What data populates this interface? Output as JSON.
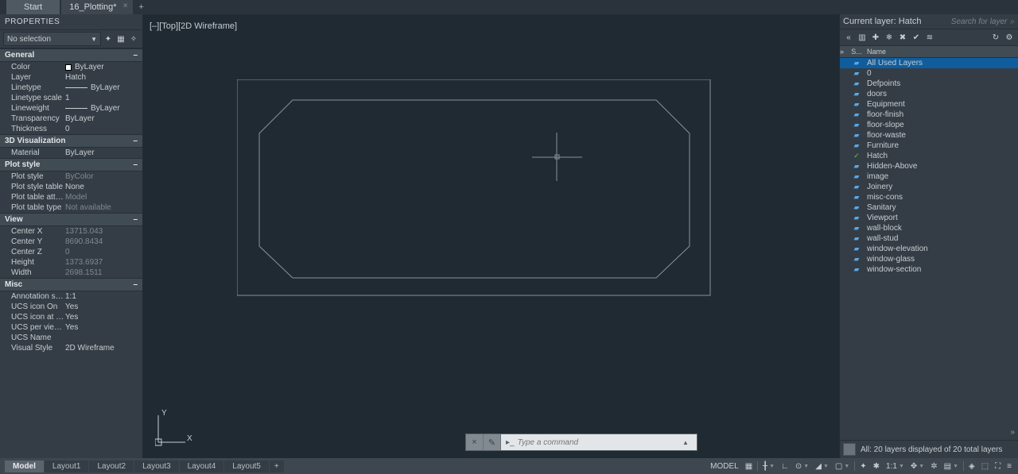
{
  "tabs": {
    "start": "Start",
    "file": "16_Plotting*"
  },
  "properties": {
    "title": "PROPERTIES",
    "selection": "No selection",
    "groups": {
      "general": "General",
      "viz3d": "3D Visualization",
      "plotstyle": "Plot style",
      "view": "View",
      "misc": "Misc"
    },
    "rows": {
      "color": {
        "l": "Color",
        "v": "ByLayer"
      },
      "layer": {
        "l": "Layer",
        "v": "Hatch"
      },
      "linetype": {
        "l": "Linetype",
        "v": "ByLayer"
      },
      "linetype_scale": {
        "l": "Linetype scale",
        "v": "1"
      },
      "lineweight": {
        "l": "Lineweight",
        "v": "ByLayer"
      },
      "transparency": {
        "l": "Transparency",
        "v": "ByLayer"
      },
      "thickness": {
        "l": "Thickness",
        "v": "0"
      },
      "material": {
        "l": "Material",
        "v": "ByLayer"
      },
      "plot_style": {
        "l": "Plot style",
        "v": "ByColor"
      },
      "plot_style_table": {
        "l": "Plot style table",
        "v": "None"
      },
      "plot_table_attached": {
        "l": "Plot table attac...",
        "v": "Model"
      },
      "plot_table_type": {
        "l": "Plot table type",
        "v": "Not available"
      },
      "center_x": {
        "l": "Center X",
        "v": "13715.043"
      },
      "center_y": {
        "l": "Center Y",
        "v": "8690.8434"
      },
      "center_z": {
        "l": "Center Z",
        "v": "0"
      },
      "height": {
        "l": "Height",
        "v": "1373.6937"
      },
      "width": {
        "l": "Width",
        "v": "2698.1511"
      },
      "anno_scale": {
        "l": "Annotation scale",
        "v": "1:1"
      },
      "ucs_on": {
        "l": "UCS icon On",
        "v": "Yes"
      },
      "ucs_origin": {
        "l": "UCS icon at ori...",
        "v": "Yes"
      },
      "ucs_per_vp": {
        "l": "UCS per viewp...",
        "v": "Yes"
      },
      "ucs_name": {
        "l": "UCS Name",
        "v": ""
      },
      "visual_style": {
        "l": "Visual Style",
        "v": "2D Wireframe"
      }
    }
  },
  "canvas": {
    "label": "[–][Top][2D Wireframe]"
  },
  "ucs": {
    "y": "Y",
    "x": "X"
  },
  "cmd": {
    "placeholder": "Type a command"
  },
  "layers": {
    "title_prefix": "Current layer: ",
    "current": "Hatch",
    "search_placeholder": "Search for layer",
    "head_status": "S...",
    "head_name": "Name",
    "items": [
      {
        "name": "All Used Layers",
        "sel": true
      },
      {
        "name": "0"
      },
      {
        "name": "Defpoints"
      },
      {
        "name": "doors"
      },
      {
        "name": "Equipment"
      },
      {
        "name": "floor-finish"
      },
      {
        "name": "floor-slope"
      },
      {
        "name": "floor-waste"
      },
      {
        "name": "Furniture"
      },
      {
        "name": "Hatch",
        "current": true
      },
      {
        "name": "Hidden-Above"
      },
      {
        "name": "image"
      },
      {
        "name": "Joinery"
      },
      {
        "name": "misc-cons"
      },
      {
        "name": "Sanitary"
      },
      {
        "name": "Viewport"
      },
      {
        "name": "wall-block"
      },
      {
        "name": "wall-stud"
      },
      {
        "name": "window-elevation"
      },
      {
        "name": "window-glass"
      },
      {
        "name": "window-section"
      }
    ],
    "status": "All: 20 layers displayed of 20 total layers"
  },
  "layouts": [
    "Model",
    "Layout1",
    "Layout2",
    "Layout3",
    "Layout4",
    "Layout5"
  ],
  "statusbar": {
    "model": "MODEL",
    "scale": "1:1"
  }
}
